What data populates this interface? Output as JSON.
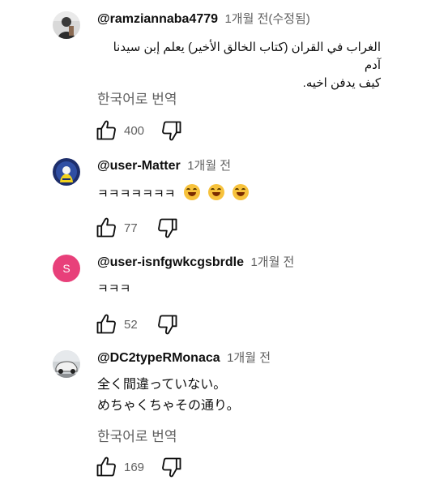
{
  "comments": [
    {
      "author": "@ramziannaba4779",
      "time": "1개월 전(수정됨)",
      "lines": [
        "الغراب في القران (كتاب الخالق الأخير) يعلم إبن سيدنا آدم",
        "كيف يدفن اخيه."
      ],
      "translate": "한국어로 번역",
      "likes": "400"
    },
    {
      "author": "@user-Matter",
      "time": "1개월 전",
      "text": "ㅋㅋㅋㅋㅋㅋㅋ",
      "likes": "77"
    },
    {
      "author": "@user-isnfgwkcgsbrdle",
      "time": "1개월 전",
      "avatar_letter": "S",
      "text": "ㅋㅋㅋ",
      "likes": "52"
    },
    {
      "author": "@DC2typeRMonaca",
      "time": "1개월 전",
      "lines": [
        "全く間違っていない。",
        "めちゃくちゃその通り。"
      ],
      "translate": "한국어로 번역",
      "likes": "169"
    }
  ],
  "icons": {
    "like": "thumbs-up-icon",
    "dislike": "thumbs-down-icon",
    "emoji": "laughing-emoji-icon"
  },
  "colors": {
    "author": "#0f0f0f",
    "meta": "#606060",
    "s_avatar": "#e8407a"
  }
}
